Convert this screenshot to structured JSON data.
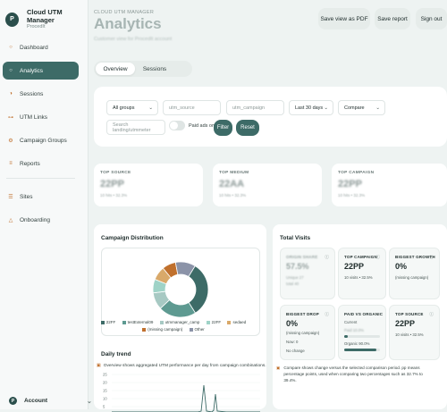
{
  "brand": {
    "initial": "P",
    "title": "Cloud UTM Manager",
    "subtitle": "ProcedIt"
  },
  "sidebar": {
    "items": [
      {
        "label": "Dashboard",
        "icon": "circle-icon",
        "active": false
      },
      {
        "label": "Analytics",
        "icon": "circle-icon",
        "active": true
      },
      {
        "label": "Sessions",
        "icon": "half-circle-icon",
        "active": false
      },
      {
        "label": "UTM Links",
        "icon": "link-icon",
        "active": false
      },
      {
        "label": "Campaign Groups",
        "icon": "gear-icon",
        "active": false
      },
      {
        "label": "Reports",
        "icon": "document-icon",
        "active": false
      }
    ],
    "secondary": [
      {
        "label": "Sites",
        "icon": "list-icon"
      },
      {
        "label": "Onboarding",
        "icon": "triangle-icon"
      }
    ],
    "account": {
      "initial": "P",
      "label": "Account"
    }
  },
  "header": {
    "kicker": "CLOUD UTM MANAGER",
    "title": "Analytics",
    "subtitle": "Customer view for ProcedIt account",
    "buttons": {
      "pdf": "Save view as PDF",
      "report": "Save report",
      "signout": "Sign out"
    }
  },
  "tabs": {
    "overview": "Overview",
    "sessions": "Sessions"
  },
  "filters": {
    "group": "All groups",
    "utm_source_placeholder": "utm_source",
    "utm_campaign_placeholder": "utm_campaign",
    "range": "Last 30 days",
    "compare": "Compare",
    "search_placeholder": "Search landing/utmmeter",
    "paid_only": "Paid ads only",
    "filter_btn": "Filter",
    "reset_btn": "Reset"
  },
  "kpis": [
    {
      "label": "TOP SOURCE",
      "value": "22PP",
      "meta": "10 hits • 32.3%"
    },
    {
      "label": "TOP MEDIUM",
      "value": "22AA",
      "meta": "10 hits • 32.3%"
    },
    {
      "label": "TOP CAMPAIGN",
      "value": "22PP",
      "meta": "10 hits • 32.3%"
    }
  ],
  "campaign_distribution": {
    "title": "Campaign Distribution",
    "legend": [
      {
        "label": "22FF",
        "color": "#3d6b67"
      },
      {
        "label": "testExternal09",
        "color": "#5e9a91"
      },
      {
        "label": "utmmanager_camp",
        "color": "#a7c9c3"
      },
      {
        "label": "22FF",
        "color": "#9fd3c7"
      },
      {
        "label": "sedaed",
        "color": "#d9a96a"
      },
      {
        "label": "(missing campaign)",
        "color": "#c0702d"
      },
      {
        "label": "Other",
        "color": "#8b93a8"
      }
    ],
    "slices": [
      32.3,
      22,
      10,
      8,
      8,
      8,
      11.7
    ]
  },
  "daily_trend": {
    "title": "Daily trend",
    "note": "Overview shows aggregated UTM performance per day from campaign combinations.",
    "y_ticks": [
      "25",
      "20",
      "15",
      "10",
      "5"
    ]
  },
  "total_visits": {
    "title": "Total Visits",
    "cards": [
      {
        "label": "ORIGIN SHARE",
        "value": "57.5%",
        "lines": [
          "Unique 27",
          "total 40"
        ],
        "blurred": true
      },
      {
        "label": "TOP CAMPAIGN",
        "value": "22PP",
        "lines": [
          "10 visits • 32.5%"
        ],
        "blurred": false
      },
      {
        "label": "BIGGEST GROWTH",
        "value": "0%",
        "lines": [
          "(missing campaign)"
        ],
        "blurred": false
      },
      {
        "label": "BIGGEST DROP",
        "value": "0%",
        "lines": [
          "(missing campaign)",
          "Now: 0",
          "No change"
        ],
        "blurred": false
      },
      {
        "label": "PAID VS ORGANIC",
        "value": "",
        "lines": [
          "Current",
          "Paid 10.0%",
          "Organic 90.0%"
        ],
        "paid_fraction": 0.1,
        "organic_fraction": 0.9,
        "blurred": false
      },
      {
        "label": "TOP SOURCE",
        "value": "22PP",
        "lines": [
          "10 visits • 32.5%"
        ],
        "blurred": false
      }
    ],
    "compare_note": "Compare shows change versus the selected comparison period. pp means percentage points, used when comparing two percentages such as 32.7% to 39.4%."
  },
  "colors": {
    "accent": "#3d6b67",
    "orange": "#c0702d"
  }
}
